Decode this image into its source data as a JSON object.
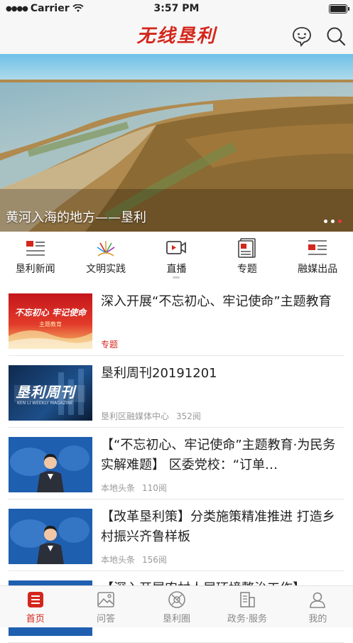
{
  "status": {
    "carrier": "Carrier",
    "time": "3:57 PM"
  },
  "header": {
    "logo": "无线垦利"
  },
  "banner": {
    "caption": "黄河入海的地方——垦利",
    "slide_count": 3,
    "active_slide": 3
  },
  "categories": [
    {
      "label": "垦利新闻",
      "icon": "news-icon"
    },
    {
      "label": "文明实践",
      "icon": "sun-icon"
    },
    {
      "label": "直播",
      "icon": "video-icon"
    },
    {
      "label": "专题",
      "icon": "document-icon"
    },
    {
      "label": "融媒出品",
      "icon": "media-icon"
    }
  ],
  "feed": [
    {
      "title": "深入开展“不忘初心、牢记使命”主题教育",
      "tag": "专题",
      "source": "",
      "reads": "",
      "thumb": "theme-education",
      "thumb_text": "不忘初心 牢记使命",
      "thumb_sub": "主题教育"
    },
    {
      "title": "垦利周刊20191201",
      "tag": "",
      "source": "垦利区融媒体中心",
      "reads": "352阅",
      "thumb": "weekly",
      "thumb_text": "垦利周刊",
      "thumb_sub": "KEN LI WEEKLY MAGAZINE"
    },
    {
      "title": "【“不忘初心、牢记使命”主题教育·为民务实解难题】 区委党校：“订单…",
      "tag": "",
      "source": "本地头条",
      "reads": "110阅",
      "thumb": "anchor"
    },
    {
      "title": "【改革垦利策】分类施策精准推进 打造乡村振兴齐鲁样板",
      "tag": "",
      "source": "本地头条",
      "reads": "156阅",
      "thumb": "anchor"
    },
    {
      "title": "【深入开展农村人居环境整治工作】",
      "tag": "",
      "source": "",
      "reads": "",
      "thumb": "anchor"
    }
  ],
  "tabbar": [
    {
      "label": "首页",
      "icon": "home-icon",
      "active": true
    },
    {
      "label": "问答",
      "icon": "qa-icon",
      "active": false
    },
    {
      "label": "垦利圈",
      "icon": "circle-icon",
      "active": false
    },
    {
      "label": "政务·服务",
      "icon": "service-icon",
      "active": false
    },
    {
      "label": "我的",
      "icon": "profile-icon",
      "active": false
    }
  ],
  "colors": {
    "accent": "#d4261c",
    "bar_bg": "#f7f7f7"
  }
}
